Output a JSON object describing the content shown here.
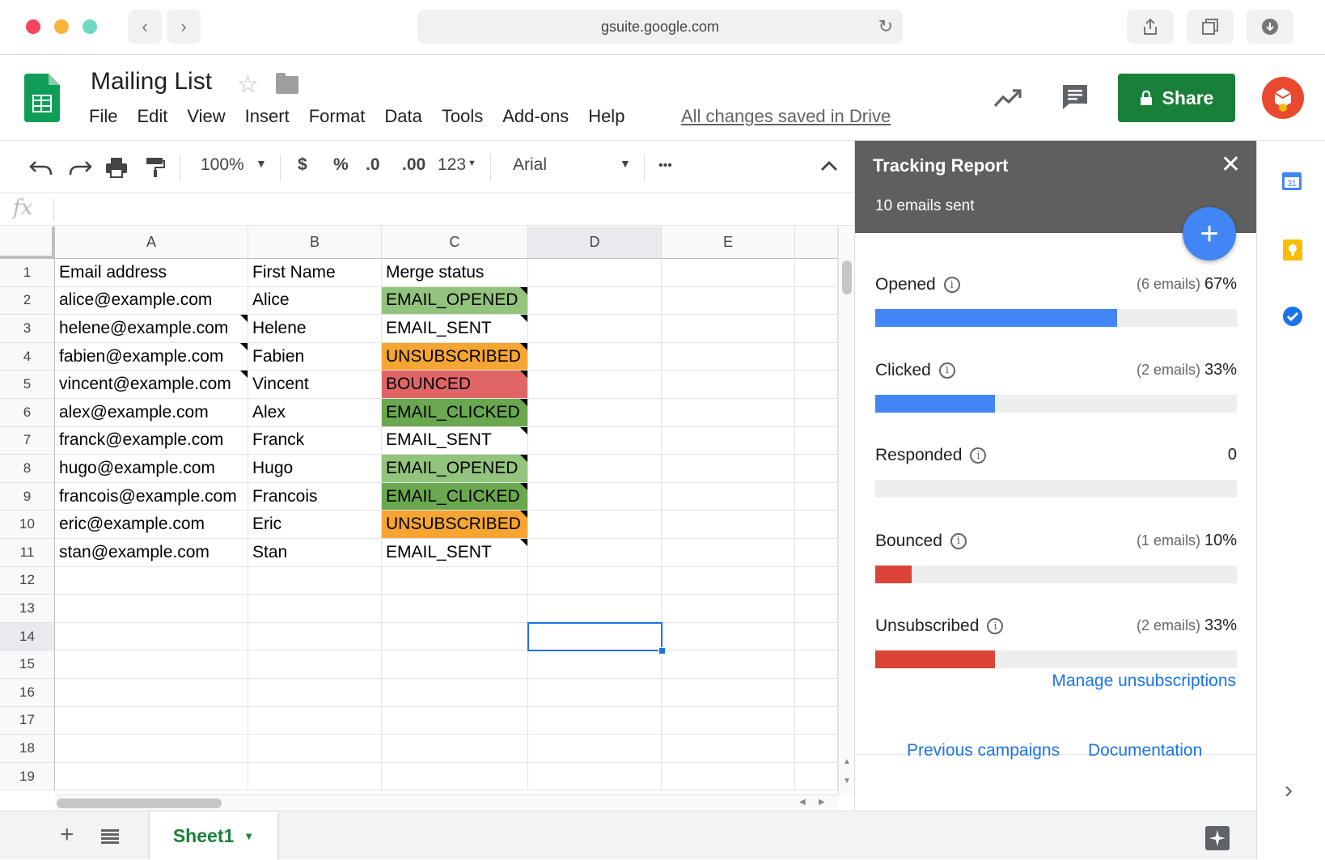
{
  "browser": {
    "url": "gsuite.google.com",
    "back_icon": "chevron-left-icon",
    "forward_icon": "chevron-right-icon"
  },
  "doc": {
    "title": "Mailing List",
    "saved_status": "All changes saved in Drive",
    "share_label": "Share",
    "menu": [
      "File",
      "Edit",
      "View",
      "Insert",
      "Format",
      "Data",
      "Tools",
      "Add-ons",
      "Help"
    ]
  },
  "toolbar": {
    "zoom": "100%",
    "currency": "$",
    "percent": "%",
    "dec_less": ".0",
    "dec_more": ".00",
    "format_more": "123",
    "font": "Arial",
    "more": "•••"
  },
  "formula": {
    "fx": "fx",
    "value": ""
  },
  "grid": {
    "columns": [
      "A",
      "B",
      "C",
      "D",
      "E"
    ],
    "rows": [
      "1",
      "2",
      "3",
      "4",
      "5",
      "6",
      "7",
      "8",
      "9",
      "10",
      "11",
      "12",
      "13",
      "14",
      "15",
      "16",
      "17",
      "18",
      "19"
    ],
    "cells": [
      [
        "Email address",
        "First Name",
        "Merge status"
      ],
      [
        "alice@example.com",
        "Alice",
        "EMAIL_OPENED"
      ],
      [
        "helene@example.com",
        "Helene",
        "EMAIL_SENT"
      ],
      [
        "fabien@example.com",
        "Fabien",
        "UNSUBSCRIBED"
      ],
      [
        "vincent@example.com",
        "Vincent",
        "BOUNCED"
      ],
      [
        "alex@example.com",
        "Alex",
        "EMAIL_CLICKED"
      ],
      [
        "franck@example.com",
        "Franck",
        "EMAIL_SENT"
      ],
      [
        "hugo@example.com",
        "Hugo",
        "EMAIL_OPENED"
      ],
      [
        "francois@example.com",
        "Francois",
        "EMAIL_CLICKED"
      ],
      [
        "eric@example.com",
        "Eric",
        "UNSUBSCRIBED"
      ],
      [
        "stan@example.com",
        "Stan",
        "EMAIL_SENT"
      ]
    ],
    "status_colors": {
      "EMAIL_OPENED": "#93c47d",
      "EMAIL_CLICKED": "#6aa84f",
      "UNSUBSCRIBED": "#f6a532",
      "BOUNCED": "#e06666",
      "EMAIL_SENT": "#ffffff"
    },
    "selected_cell": "D14"
  },
  "sheet_tab": {
    "label": "Sheet1"
  },
  "panel": {
    "title": "Tracking Report",
    "subtitle": "10 emails sent",
    "metrics": [
      {
        "label": "Opened",
        "count": "(6 emails)",
        "value": "67%",
        "percent": 67,
        "color": "#4285f4"
      },
      {
        "label": "Clicked",
        "count": "(2 emails)",
        "value": "33%",
        "percent": 33,
        "color": "#4285f4"
      },
      {
        "label": "Responded",
        "count": "",
        "value": "0",
        "percent": 0,
        "color": "#4285f4"
      },
      {
        "label": "Bounced",
        "count": "(1 emails)",
        "value": "10%",
        "percent": 10,
        "color": "#db4437"
      },
      {
        "label": "Unsubscribed",
        "count": "(2 emails)",
        "value": "33%",
        "percent": 33,
        "color": "#db4437"
      }
    ],
    "manage_link": "Manage unsubscriptions",
    "previous_link": "Previous campaigns",
    "docs_link": "Documentation"
  },
  "colors": {
    "share_green": "#188038",
    "selection_blue": "#1a73e8",
    "panel_header": "#5f5f5f",
    "link_blue": "#1a73e8"
  }
}
